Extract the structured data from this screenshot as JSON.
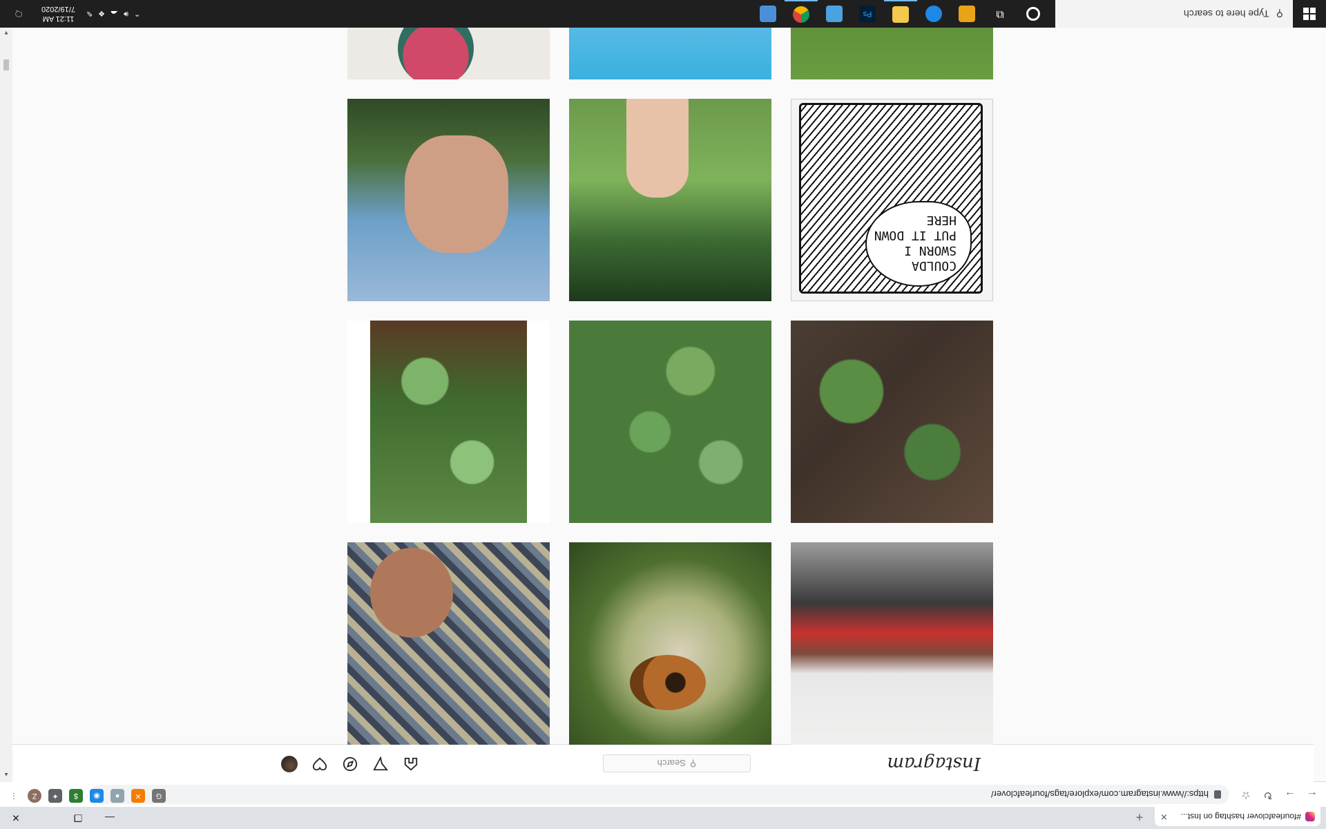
{
  "browser": {
    "tab_title": "#fourleafclover hashtag on Inst...",
    "new_tab": "+",
    "url": "https://www.instagram.com/explore/tags/fourleafclover/",
    "window_controls": {
      "minimize": "—",
      "maximize": "❐",
      "close": "✕"
    },
    "extensions": [
      {
        "name": "Z",
        "color": "#8d6e63"
      },
      {
        "name": "",
        "color": "#5f6368"
      },
      {
        "name": "$",
        "color": "#2e7d32"
      },
      {
        "name": "",
        "color": "#1e88e5"
      },
      {
        "name": "",
        "color": "#90a4ae"
      },
      {
        "name": "",
        "color": "#f57c00"
      },
      {
        "name": "",
        "color": "#757575"
      }
    ]
  },
  "instagram": {
    "logo": "Instagram",
    "search_placeholder": "Search",
    "nav_icons": [
      "home-icon",
      "direct-icon",
      "explore-icon",
      "activity-icon",
      "profile-avatar"
    ]
  },
  "grid": {
    "rows": [
      [
        {
          "name": "clover-photo-grass"
        },
        {
          "name": "clover-photo-pastel"
        },
        {
          "name": "clover-photo-tattoo"
        }
      ],
      [
        {
          "name": "comic-clover-panel",
          "text": [
            "COULDA",
            "SWORN I",
            "PUT IT DOWN",
            "HERE"
          ]
        },
        {
          "name": "hand-clover-photo"
        },
        {
          "name": "sky-clover-photo"
        }
      ],
      [
        {
          "name": "clover-soil-photo"
        },
        {
          "name": "clover-patch-photo"
        },
        {
          "name": "clover-leaves-photo"
        }
      ],
      [
        {
          "name": "garage-photo"
        },
        {
          "name": "resin-butterfly-photo"
        },
        {
          "name": "man-plaid-photo"
        }
      ]
    ]
  },
  "taskbar": {
    "search_placeholder": "Type here to search",
    "time": "11:21 AM",
    "date": "7/19/2020",
    "apps": [
      {
        "name": "cortana-icon",
        "color": "#ffffff"
      },
      {
        "name": "task-view-icon",
        "color": "#ffffff"
      },
      {
        "name": "store-icon",
        "color": "#e8a317"
      },
      {
        "name": "edge-icon",
        "color": "#1e88e5"
      },
      {
        "name": "explorer-icon",
        "color": "#f2c94c"
      },
      {
        "name": "photoshop-icon",
        "color": "#001e36"
      },
      {
        "name": "photos-icon",
        "color": "#4aa3df"
      },
      {
        "name": "chrome-icon",
        "color": "#db4437"
      },
      {
        "name": "settings-icon",
        "color": "#4a90d9"
      }
    ]
  }
}
